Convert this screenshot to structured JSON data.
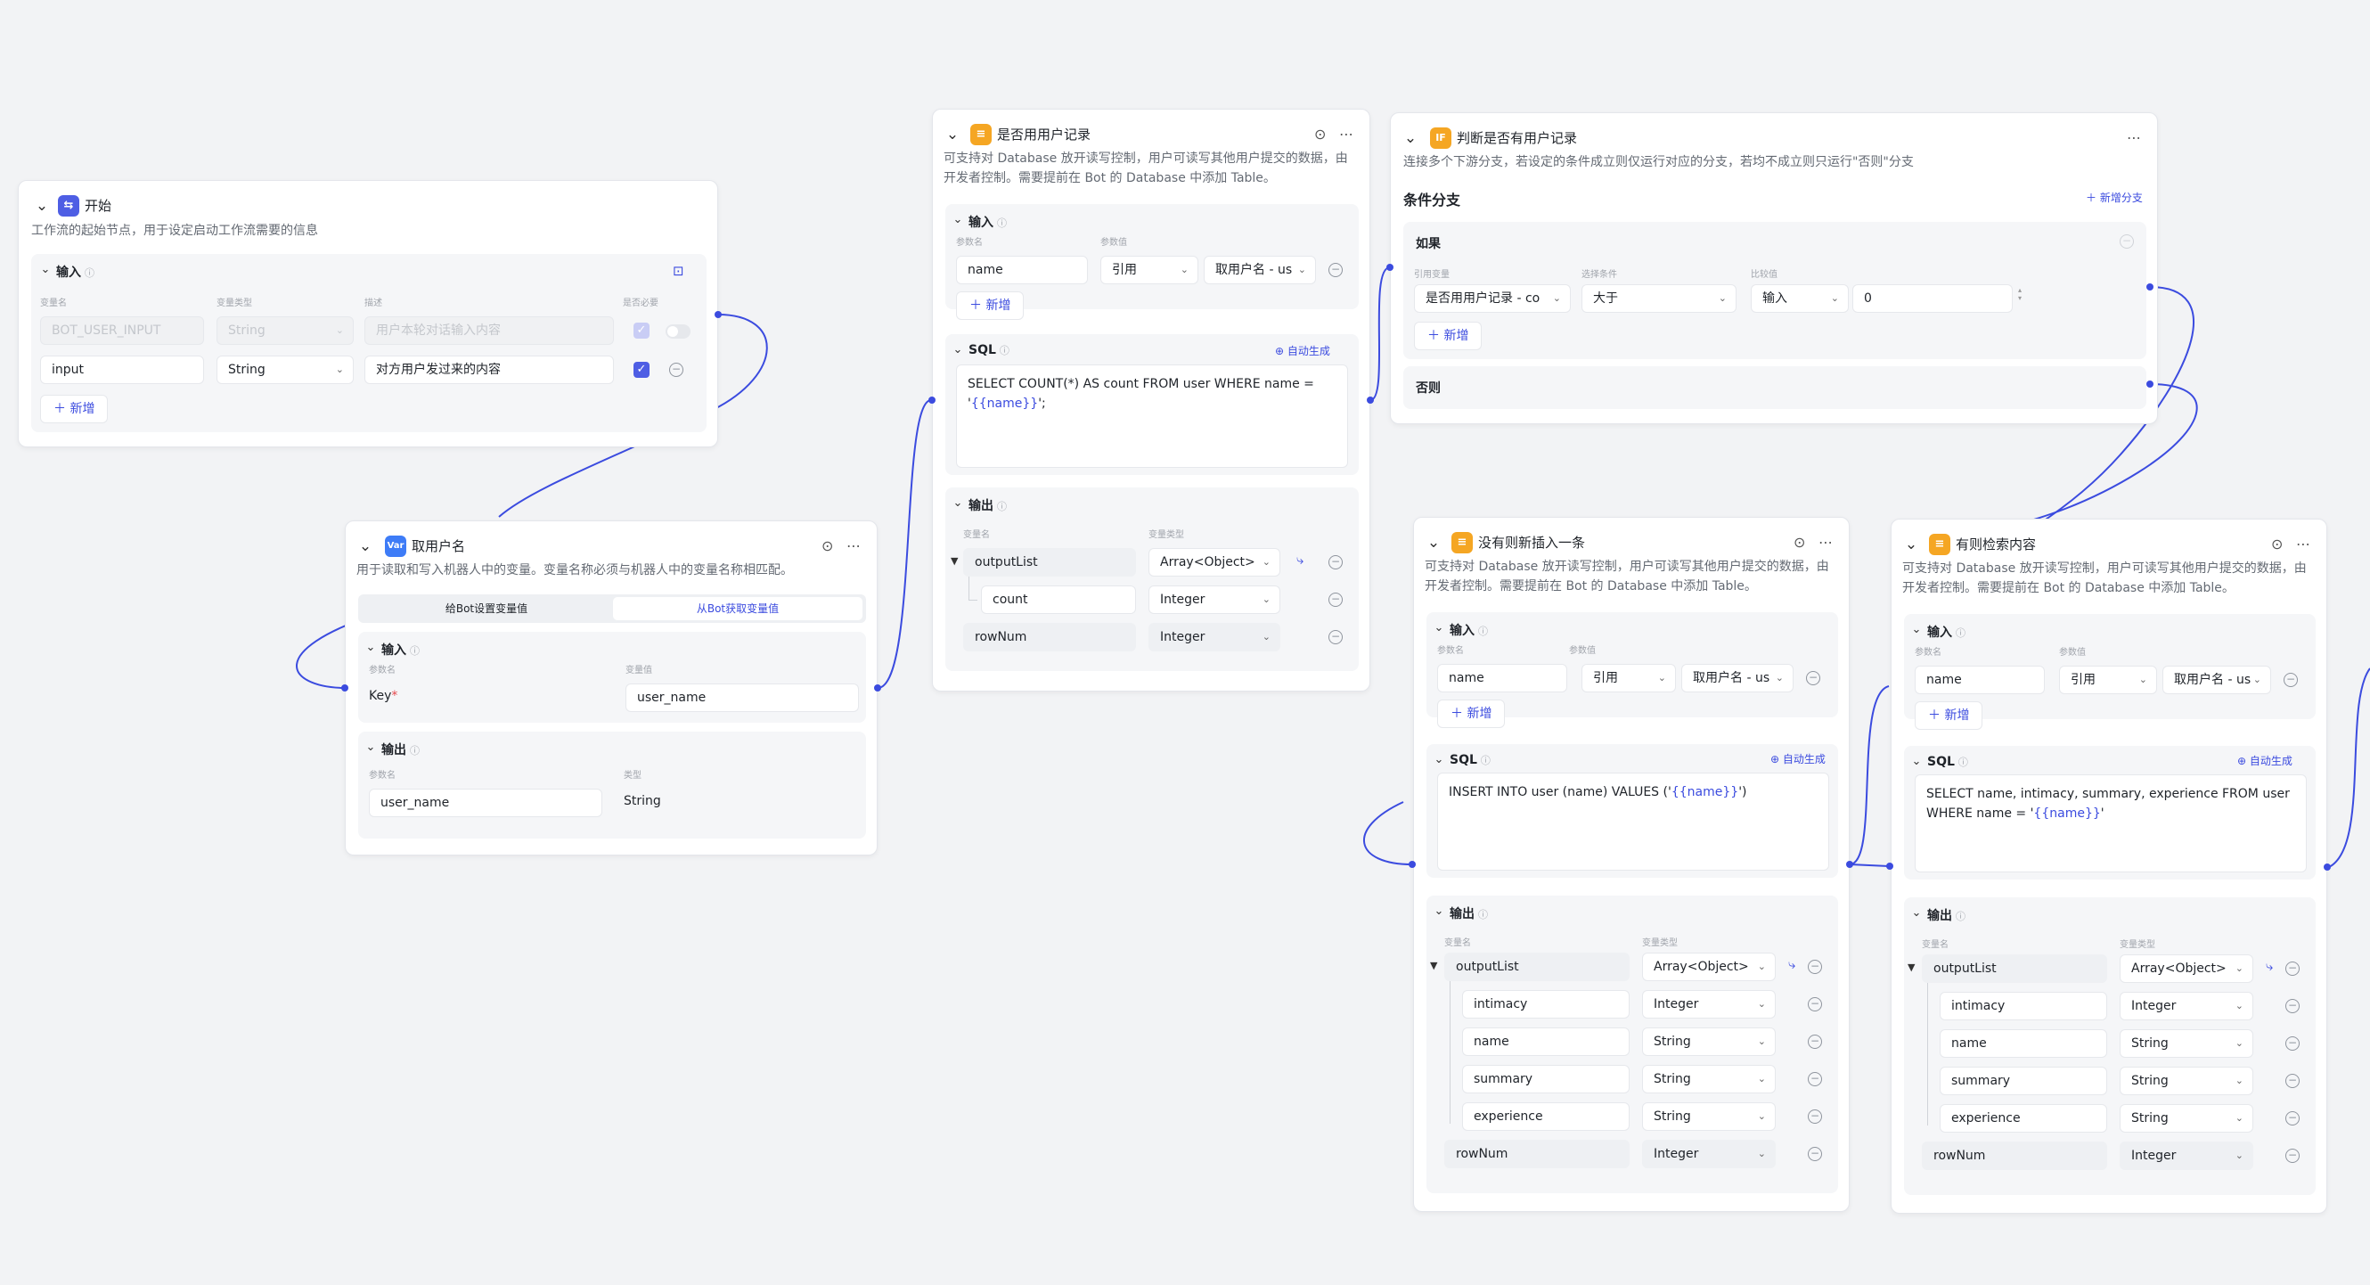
{
  "common": {
    "input": "输入",
    "output": "输出",
    "add": "新增",
    "sql": "SQL",
    "auto_generate": "自动生成",
    "param_name": "参数名",
    "param_value": "参数值",
    "var_name": "变量名",
    "var_type": "变量类型",
    "type": "类型",
    "quote": "引用",
    "get_username_ref": "取用户名 - us"
  },
  "start_node": {
    "title": "开始",
    "desc": "工作流的起始节点，用于设定启动工作流需要的信息",
    "col_desc": "描述",
    "col_required": "是否必要",
    "rows": [
      {
        "name": "BOT_USER_INPUT",
        "type": "String",
        "desc_placeholder": "用户本轮对话输入内容"
      },
      {
        "name": "input",
        "type": "String",
        "desc": "对方用户发过来的内容"
      }
    ]
  },
  "var_node": {
    "title": "取用户名",
    "desc": "用于读取和写入机器人中的变量。变量名称必须与机器人中的变量名称相匹配。",
    "tabs": [
      "给Bot设置变量值",
      "从Bot获取变量值"
    ],
    "key_label": "Key",
    "key_value": "user_name",
    "output_name": "user_name",
    "output_type": "String"
  },
  "query_node": {
    "title": "是否用用户记录",
    "desc_line1": "可支持对 Database 放开读写控制，用户可读写其他用户提交的数据，由",
    "desc_line2": "开发者控制。需要提前在 Bot 的 Database 中添加 Table。",
    "input_name": "name",
    "sql_text": "SELECT COUNT(*) AS count FROM user WHERE name =",
    "sql_quote_open": "'",
    "sql_var": "{{name}}",
    "sql_tail": "';",
    "outputs": [
      {
        "name": "outputList",
        "type": "Array<Object>"
      },
      {
        "name": "count",
        "type": "Integer"
      },
      {
        "name": "rowNum",
        "type": "Integer"
      }
    ]
  },
  "condition_node": {
    "title": "判断是否有用户记录",
    "desc": "连接多个下游分支，若设定的条件成立则仅运行对应的分支，若均不成立则只运行\"否则\"分支",
    "section": "条件分支",
    "add_branch": "新增分支",
    "if_label": "如果",
    "col_ref": "引用变量",
    "col_cond": "选择条件",
    "col_cmp": "比较值",
    "ref_value": "是否用用户记录 - co",
    "cond_value": "大于",
    "cmp_type": "输入",
    "cmp_value": "0",
    "else_label": "否则"
  },
  "insert_node": {
    "title": "没有则新插入一条",
    "desc_line1": "可支持对 Database 放开读写控制，用户可读写其他用户提交的数据，由",
    "desc_line2": "开发者控制。需要提前在 Bot 的 Database 中添加 Table。",
    "input_name": "name",
    "sql_text": "INSERT INTO user (name) VALUES ('",
    "sql_var": "{{name}}",
    "sql_tail": "')",
    "outputs": [
      {
        "name": "outputList",
        "type": "Array<Object>"
      },
      {
        "name": "intimacy",
        "type": "Integer"
      },
      {
        "name": "name",
        "type": "String"
      },
      {
        "name": "summary",
        "type": "String"
      },
      {
        "name": "experience",
        "type": "String"
      },
      {
        "name": "rowNum",
        "type": "Integer"
      }
    ]
  },
  "search_node": {
    "title": "有则检索内容",
    "desc_line1": "可支持对 Database 放开读写控制，用户可读写其他用户提交的数据，由",
    "desc_line2": "开发者控制。需要提前在 Bot 的 Database 中添加 Table。",
    "input_name": "name",
    "sql_line1": "SELECT name, intimacy, summary, experience FROM user",
    "sql_line2": "WHERE name = '",
    "sql_var": "{{name}}",
    "sql_tail": "'",
    "outputs": [
      {
        "name": "outputList",
        "type": "Array<Object>"
      },
      {
        "name": "intimacy",
        "type": "Integer"
      },
      {
        "name": "name",
        "type": "String"
      },
      {
        "name": "summary",
        "type": "String"
      },
      {
        "name": "experience",
        "type": "String"
      },
      {
        "name": "rowNum",
        "type": "Integer"
      }
    ]
  },
  "icons": [
    "chevron-down-icon",
    "start-node-icon",
    "database-node-icon",
    "condition-node-icon",
    "variable-node-icon",
    "run-icon",
    "more-icon",
    "info-icon",
    "add-icon",
    "minus-circle-icon",
    "checkbox-icon",
    "toggle-icon",
    "auto-generate-icon",
    "branch-icon",
    "caret-down-icon"
  ],
  "colors": {
    "accent": "#3b4bdf",
    "start_icon": "#4e5ee4",
    "db_icon": "#f5a623",
    "var_icon": "#3e7cf7",
    "canvas": "#f2f3f5"
  }
}
